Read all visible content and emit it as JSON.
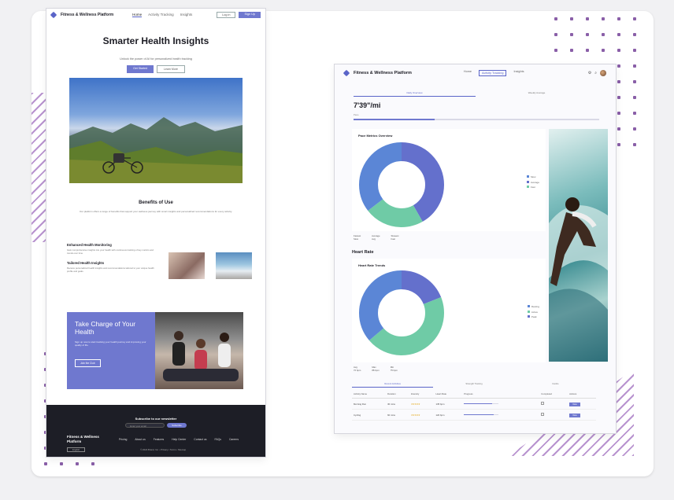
{
  "left_page": {
    "brand": "Fitness & Wellness Platform",
    "nav_links": [
      "Home",
      "Activity Tracking",
      "Insights"
    ],
    "login_label": "Log in",
    "signup_label": "Sign Up",
    "hero_title": "Smarter Health Insights",
    "hero_subtitle": "Unlock the power of AI for personalized health tracking",
    "cta_primary": "Get Started",
    "cta_secondary": "Learn More",
    "benefits_title": "Benefits of Use",
    "benefits_intro": "Our platform offers a range of benefits that support your wellness journey with smart insights and personalized recommendations for every activity.",
    "benefit_1_title": "Enhanced Health Monitoring",
    "benefit_1_text": "Gain comprehensive insights into your health with continuous tracking of key metrics and trends over time.",
    "benefit_2_title": "Tailored Health Insights",
    "benefit_2_text": "Receive personalized health insights and recommendations tailored to your unique health profile and goals.",
    "banner_title": "Take Charge of Your Health",
    "banner_text": "Sign up now to start tracking your health journey and improving your quality of life.",
    "banner_button": "Join the Club",
    "subscribe_title": "Subscribe to our newsletter",
    "subscribe_placeholder": "Enter your email",
    "subscribe_button": "Subscribe",
    "footer_brand": "Fitness & Wellness Platform",
    "footer_links": [
      "Pricing",
      "About us",
      "Features",
      "Help Center",
      "Contact us",
      "FAQs",
      "Careers"
    ],
    "language": "English",
    "copyright": "© 2024 Brand, Inc. • Privacy • Terms • Sitemap"
  },
  "right_page": {
    "brand": "Fitness & Wellness Platform",
    "nav_links": [
      "Home",
      "Activity Tracking",
      "Insights"
    ],
    "active_nav": 1,
    "tabs": [
      "Daily Overview",
      "Weekly Average"
    ],
    "pace_value": "7'39\"/mi",
    "pace_label": "Pace",
    "pace_progress": 0.33,
    "card1_title": "Pace Metrics Overview",
    "card1_legend": [
      "Slow",
      "Average",
      "Fast"
    ],
    "card1_stats": [
      {
        "label": "Fastest",
        "value": "Slow"
      },
      {
        "label": "Average",
        "value": "Avg"
      },
      {
        "label": "Slowest",
        "value": "Fast"
      }
    ],
    "heart_rate_heading": "Heart Rate",
    "card2_title": "Heart Rate Trends",
    "card2_legend": [
      "Resting",
      "Active",
      "Peak"
    ],
    "card2_stats": [
      {
        "label": "Avg",
        "value": "72 bpm"
      },
      {
        "label": "Max",
        "value": "88 bpm"
      },
      {
        "label": "Min",
        "value": "75 bpm"
      }
    ],
    "table_tabs": [
      "Recent Activities",
      "Strength Training",
      "Cardio"
    ],
    "table_headers": [
      "Activity Name",
      "Duration",
      "Intensity",
      "Heart Rate",
      "Progress",
      "Completed",
      "Actions"
    ],
    "rows": [
      {
        "name": "Morning Run",
        "duration": "30 mins",
        "stars": "★★★★★",
        "hr": "135 bpm",
        "progress": 0.8,
        "action": "View"
      },
      {
        "name": "Cycling",
        "duration": "60 mins",
        "stars": "★★★★★",
        "hr": "120 bpm",
        "progress": 0.85,
        "action": "View"
      }
    ]
  },
  "colors": {
    "accent": "#6f78cf",
    "donut_blue": "#5b86d6",
    "donut_indigo": "#6470cc",
    "donut_green": "#6fcba6"
  }
}
